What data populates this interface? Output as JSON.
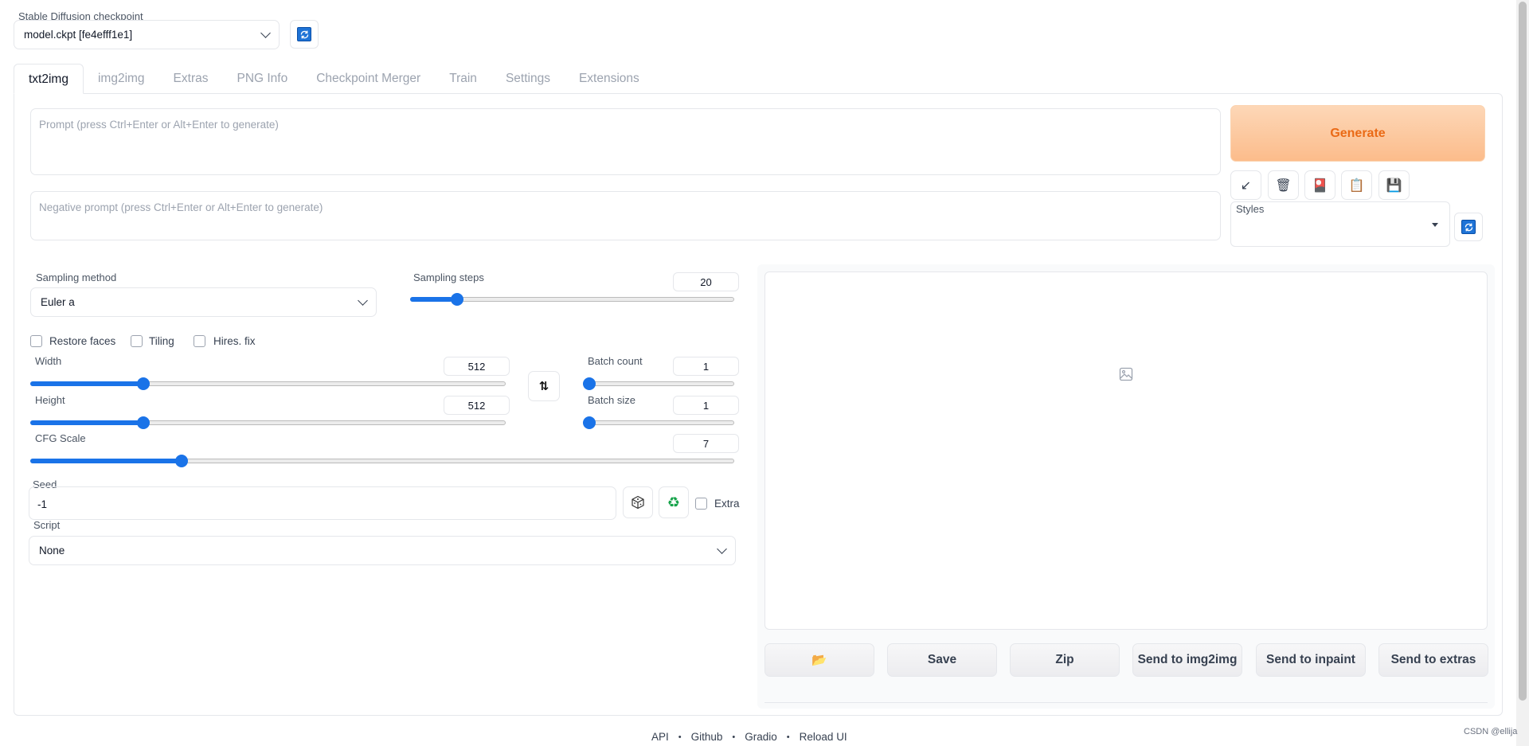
{
  "checkpoint": {
    "label": "Stable Diffusion checkpoint",
    "value": "model.ckpt [fe4efff1e1]"
  },
  "tabs": [
    {
      "label": "txt2img",
      "active": true
    },
    {
      "label": "img2img"
    },
    {
      "label": "Extras"
    },
    {
      "label": "PNG Info"
    },
    {
      "label": "Checkpoint Merger"
    },
    {
      "label": "Train"
    },
    {
      "label": "Settings"
    },
    {
      "label": "Extensions"
    }
  ],
  "prompt": {
    "placeholder": "Prompt (press Ctrl+Enter or Alt+Enter to generate)"
  },
  "negative_prompt": {
    "placeholder": "Negative prompt (press Ctrl+Enter or Alt+Enter to generate)"
  },
  "generate": {
    "label": "Generate"
  },
  "tool_buttons": [
    {
      "name": "read-params-icon",
      "glyph": "↙"
    },
    {
      "name": "trash-icon",
      "glyph": "🗑"
    },
    {
      "name": "extra-networks-icon",
      "glyph": "🎴"
    },
    {
      "name": "clipboard-icon",
      "glyph": "📋"
    },
    {
      "name": "save-style-icon",
      "glyph": "💾"
    }
  ],
  "styles": {
    "label": "Styles",
    "value": ""
  },
  "sampling_method": {
    "label": "Sampling method",
    "value": "Euler a"
  },
  "sampling_steps": {
    "label": "Sampling steps",
    "value": "20",
    "fraction": 0.13
  },
  "checks": {
    "restore_faces": "Restore faces",
    "tiling": "Tiling",
    "hires_fix": "Hires. fix"
  },
  "width": {
    "label": "Width",
    "value": "512",
    "fraction": 0.23
  },
  "height": {
    "label": "Height",
    "value": "512",
    "fraction": 0.23
  },
  "batch_count": {
    "label": "Batch count",
    "value": "1",
    "fraction": 0.0
  },
  "batch_size": {
    "label": "Batch size",
    "value": "1",
    "fraction": 0.0
  },
  "cfg_scale": {
    "label": "CFG Scale",
    "value": "7",
    "fraction": 0.21
  },
  "seed": {
    "label": "Seed",
    "value": "-1",
    "extra_label": "Extra"
  },
  "script": {
    "label": "Script",
    "value": "None"
  },
  "output_buttons": [
    {
      "name": "open-folder-button",
      "label": "📂"
    },
    {
      "name": "save-button",
      "label": "Save"
    },
    {
      "name": "zip-button",
      "label": "Zip"
    },
    {
      "name": "send-to-img2img-button",
      "label": "Send to img2img"
    },
    {
      "name": "send-to-inpaint-button",
      "label": "Send to inpaint"
    },
    {
      "name": "send-to-extras-button",
      "label": "Send to extras"
    }
  ],
  "footer": {
    "api": "API",
    "github": "Github",
    "gradio": "Gradio",
    "reload": "Reload UI",
    "sep": "•"
  },
  "watermark": "CSDN @ellija",
  "colors": {
    "accent": "#1a73e8",
    "generate_text": "#ea6a16",
    "generate_bg": "#fcbc8b"
  }
}
